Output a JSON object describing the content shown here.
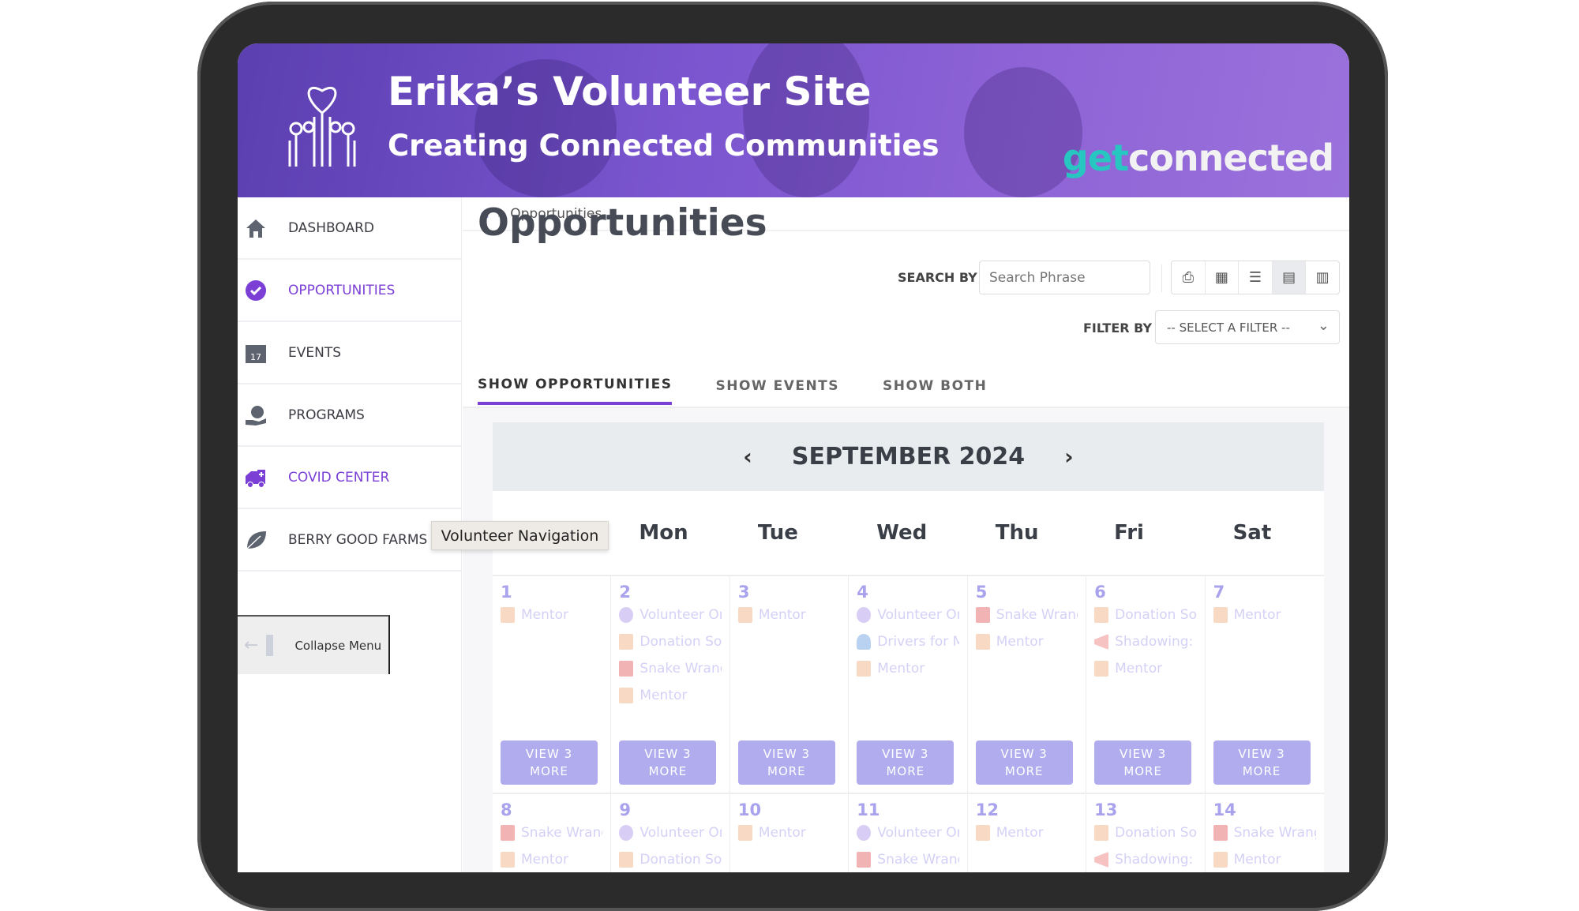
{
  "banner": {
    "title": "Erika’s Volunteer Site",
    "subtitle": "Creating Connected Communities",
    "logo_text": "getconnected"
  },
  "sidebar": {
    "items": [
      {
        "label": "DASHBOARD",
        "icon": "home-icon",
        "active": false
      },
      {
        "label": "OPPORTUNITIES",
        "icon": "check-circle-icon",
        "active": true
      },
      {
        "label": "EVENTS",
        "icon": "calendar-icon",
        "active": false
      },
      {
        "label": "PROGRAMS",
        "icon": "globe-hand-icon",
        "active": false
      },
      {
        "label": "COVID CENTER",
        "icon": "ambulance-icon",
        "active": true
      },
      {
        "label": "BERRY GOOD FARMS",
        "icon": "leaf-icon",
        "active": false
      }
    ],
    "collapse_label": "Collapse Menu",
    "tooltip": "Volunteer Navigation"
  },
  "breadcrumb": {
    "current": "Opportunities"
  },
  "page": {
    "title": "Opportunities",
    "search_label": "SEARCH BY",
    "search_placeholder": "Search Phrase",
    "filter_label": "FILTER BY",
    "filter_value": "-- SELECT A FILTER --",
    "views": [
      "print-icon",
      "grid-icon",
      "list-icon",
      "calendar-icon",
      "map-icon"
    ],
    "active_view": "calendar-icon"
  },
  "tabs": [
    {
      "label": "SHOW OPPORTUNITIES",
      "active": true
    },
    {
      "label": "SHOW EVENTS",
      "active": false
    },
    {
      "label": "SHOW BOTH",
      "active": false
    }
  ],
  "colors": {
    "accent": "#7b3fd6",
    "more_button": "#b0acee",
    "day_number": "#a9a2ec"
  },
  "calendar": {
    "month": "SEPTEMBER 2024",
    "days_of_week": [
      "",
      "Mon",
      "Tue",
      "Wed",
      "Thu",
      "Fri",
      "Sat"
    ],
    "more_label": "VIEW 3 MORE",
    "weeks": [
      [
        {
          "day": "1",
          "events": [
            [
              "book",
              "Mentor"
            ]
          ],
          "more": true
        },
        {
          "day": "2",
          "events": [
            [
              "grapes",
              "Volunteer Or"
            ],
            [
              "book",
              "Donation Sor"
            ],
            [
              "ambulance",
              "Snake Wrang"
            ],
            [
              "book",
              "Mentor"
            ]
          ],
          "more": true
        },
        {
          "day": "3",
          "events": [
            [
              "book",
              "Mentor"
            ]
          ],
          "more": true
        },
        {
          "day": "4",
          "events": [
            [
              "grapes",
              "Volunteer Or"
            ],
            [
              "person",
              "Drivers for M"
            ],
            [
              "book",
              "Mentor"
            ]
          ],
          "more": true
        },
        {
          "day": "5",
          "events": [
            [
              "ambulance",
              "Snake Wrang"
            ],
            [
              "book",
              "Mentor"
            ]
          ],
          "more": true
        },
        {
          "day": "6",
          "events": [
            [
              "book",
              "Donation Sor"
            ],
            [
              "megaphone",
              "Shadowing: L"
            ],
            [
              "book",
              "Mentor"
            ]
          ],
          "more": true
        },
        {
          "day": "7",
          "events": [
            [
              "book",
              "Mentor"
            ]
          ],
          "more": true
        }
      ],
      [
        {
          "day": "8",
          "events": [
            [
              "ambulance",
              "Snake Wrang"
            ],
            [
              "book",
              "Mentor"
            ]
          ]
        },
        {
          "day": "9",
          "events": [
            [
              "grapes",
              "Volunteer Or"
            ],
            [
              "book",
              "Donation Sor"
            ]
          ]
        },
        {
          "day": "10",
          "events": [
            [
              "book",
              "Mentor"
            ]
          ]
        },
        {
          "day": "11",
          "events": [
            [
              "grapes",
              "Volunteer Or"
            ],
            [
              "ambulance",
              "Snake Wrang"
            ]
          ]
        },
        {
          "day": "12",
          "events": [
            [
              "book",
              "Mentor"
            ]
          ]
        },
        {
          "day": "13",
          "events": [
            [
              "book",
              "Donation Sor"
            ],
            [
              "megaphone",
              "Shadowing: L"
            ]
          ]
        },
        {
          "day": "14",
          "events": [
            [
              "ambulance",
              "Snake Wrang"
            ],
            [
              "book",
              "Mentor"
            ]
          ]
        }
      ]
    ]
  }
}
